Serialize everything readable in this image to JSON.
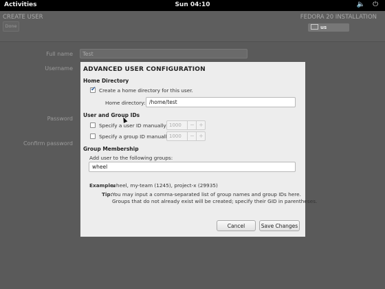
{
  "topbar": {
    "activities": "Activities",
    "clock": "Sun 04:10",
    "tray_icons": [
      "volume-icon",
      "power-icon"
    ],
    "tray_glyphs": "🔈 ⏻"
  },
  "installer": {
    "title": "CREATE USER",
    "done_label": "Done",
    "installation_title": "FEDORA 20 INSTALLATION",
    "keyboard_layout": "us",
    "form_labels": {
      "full_name": "Full name",
      "username": "Username",
      "password": "Password",
      "confirm_password": "Confirm password"
    },
    "full_name_value": "Test"
  },
  "dialog": {
    "title": "ADVANCED USER CONFIGURATION",
    "home_section": "Home Directory",
    "create_home_label": "Create a home directory for this user.",
    "create_home_checked": true,
    "home_dir_label": "Home directory:",
    "home_dir_value": "/home/test",
    "ids_section": "User and Group IDs",
    "uid_label": "Specify a user ID manually:",
    "uid_checked": false,
    "uid_value": "1000",
    "gid_label": "Specify a group ID manually:",
    "gid_checked": false,
    "gid_value": "1000",
    "group_section": "Group Membership",
    "add_groups_label": "Add user to the following groups:",
    "groups_value": "wheel",
    "example_label": "Example:",
    "example_text": "wheel, my-team (1245), project-x (29935)",
    "tip_label": "Tip:",
    "tip_line1": "You may input a comma-separated list of group names and group IDs here.",
    "tip_line2": "Groups that do not already exist will be created; specify their GID in parentheses.",
    "cancel_label": "Cancel",
    "save_label": "Save Changes"
  }
}
